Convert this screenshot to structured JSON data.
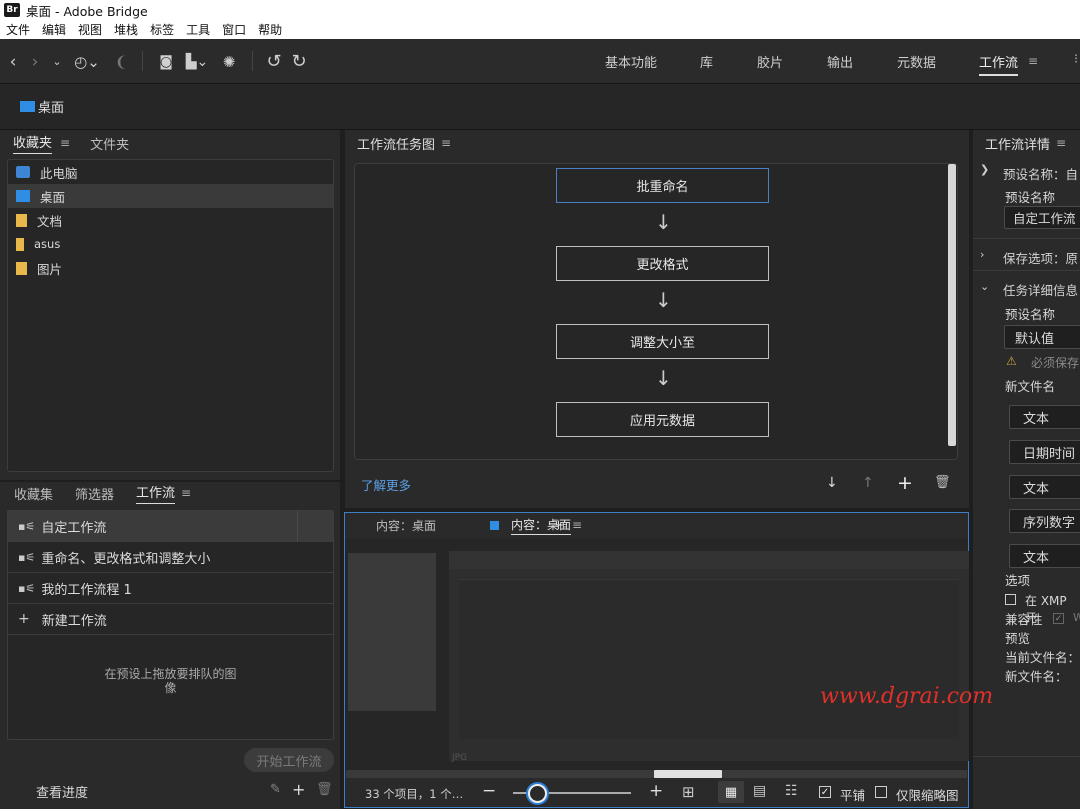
{
  "window": {
    "title": "桌面 - Adobe Bridge",
    "app_badge": "Br"
  },
  "menu": [
    "文件",
    "编辑",
    "视图",
    "堆栈",
    "标签",
    "工具",
    "窗口",
    "帮助"
  ],
  "workspaces": {
    "items": [
      "基本功能",
      "库",
      "胶片",
      "输出",
      "元数据",
      "工作流"
    ],
    "active": "工作流"
  },
  "path": {
    "label": "桌面"
  },
  "favorites": {
    "tabs": [
      "收藏夹",
      "文件夹"
    ],
    "items": [
      {
        "label": "此电脑",
        "icon": "computer-icon"
      },
      {
        "label": "桌面",
        "icon": "desktop-icon",
        "selected": true
      },
      {
        "label": "文档",
        "icon": "document-folder-icon"
      },
      {
        "label": "asus",
        "icon": "user-folder-icon"
      },
      {
        "label": "图片",
        "icon": "pictures-folder-icon"
      }
    ]
  },
  "workflow_panel": {
    "tabs": [
      "收藏集",
      "筛选器",
      "工作流"
    ],
    "items": [
      "自定工作流",
      "重命名、更改格式和调整大小",
      "我的工作流程 1"
    ],
    "new_label": "新建工作流",
    "drop_hint_line1": "在预设上拖放要排队的图",
    "drop_hint_line2": "像",
    "start_button": "开始工作流",
    "progress_label": "查看进度"
  },
  "task_graph": {
    "title": "工作流任务图",
    "nodes": [
      "批重命名",
      "更改格式",
      "调整大小至",
      "应用元数据"
    ],
    "learn_more": "了解更多"
  },
  "content": {
    "tabs": [
      "内容：桌面",
      "内容：桌面"
    ],
    "status": "33 个项目，1 个…",
    "stack_label": "平铺",
    "thumb_only_label": "仅限缩略图",
    "thumb_caption": "JPG"
  },
  "details": {
    "title": "工作流详情",
    "preset_section": "预设名称：自",
    "preset_label": "预设名称",
    "preset_value": "自定工作流",
    "save_section": "保存选项：原",
    "task_section": "任务详细信息",
    "task_preset_label": "预设名称",
    "task_preset_value": "默认值",
    "warning": "必须保存",
    "new_filename_label": "新文件名",
    "rename_fields": [
      "文本",
      "日期时间",
      "文本",
      "序列数字",
      "文本"
    ],
    "options_label": "选项",
    "xmp_label": "在 XMP 元",
    "compat_label": "兼容性",
    "compat_value": "W",
    "preview_label": "预览",
    "current_name_label": "当前文件名：",
    "new_name_label": "新文件名："
  },
  "watermark": "www.dgrai.com",
  "colors": {
    "accent": "#4b7fc4",
    "folder": "#e8b84a",
    "link": "#5b9ee6",
    "watermark": "#e0302a"
  }
}
